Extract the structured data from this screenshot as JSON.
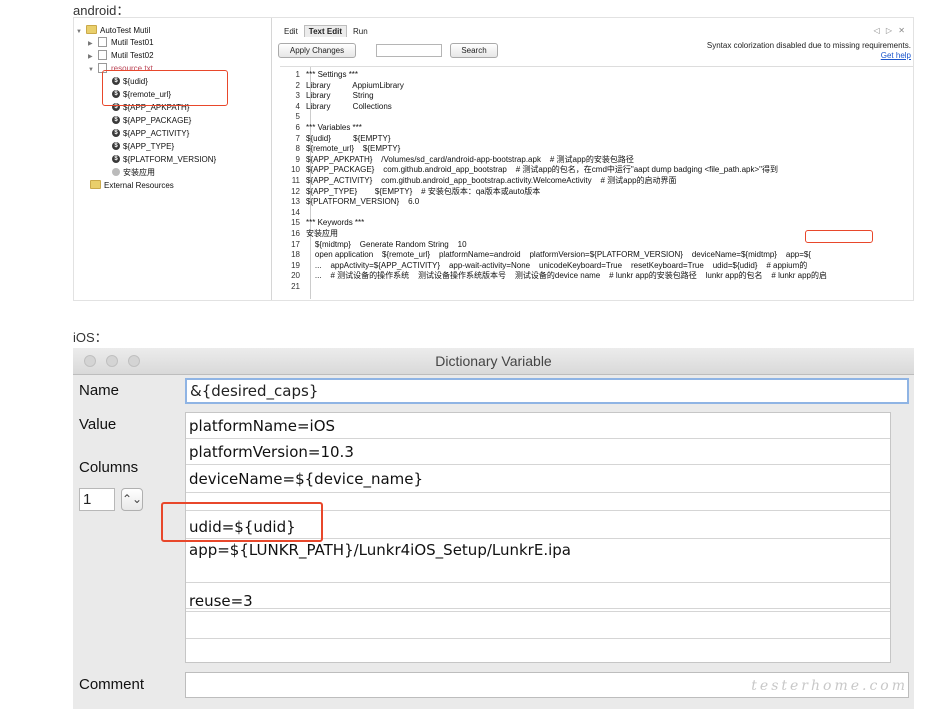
{
  "android_caption": "android：",
  "ios_caption": "iOS：",
  "android": {
    "tree": [
      {
        "label": "AutoTest Mutil",
        "type": "folder",
        "toggle": "▼"
      },
      {
        "label": "Mutil Test01",
        "type": "file",
        "toggle": "▶"
      },
      {
        "label": "Mutil Test02",
        "type": "file",
        "toggle": "▶"
      },
      {
        "label": "resource.txt",
        "type": "file",
        "toggle": "▼"
      },
      {
        "label": "${udid}",
        "type": "var"
      },
      {
        "label": "${remote_url}",
        "type": "var"
      },
      {
        "label": "${APP_APKPATH}",
        "type": "var"
      },
      {
        "label": "${APP_PACKAGE}",
        "type": "var"
      },
      {
        "label": "${APP_ACTIVITY}",
        "type": "var"
      },
      {
        "label": "${APP_TYPE}",
        "type": "var"
      },
      {
        "label": "${PLATFORM_VERSION}",
        "type": "var"
      },
      {
        "label": "安装应用",
        "type": "kw"
      },
      {
        "label": "External Resources",
        "type": "folder"
      }
    ],
    "tabs": [
      "Edit",
      "Text Edit",
      "Run"
    ],
    "tab_controls": "◁ ▷ ✕",
    "apply_button": "Apply Changes",
    "search_button": "Search",
    "syntax_message": "Syntax colorization disabled due to missing requirements.",
    "get_help": "Get help",
    "code_lines": [
      {
        "n": "1",
        "t": "*** Settings ***"
      },
      {
        "n": "2",
        "t": "Library          AppiumLibrary"
      },
      {
        "n": "3",
        "t": "Library          String"
      },
      {
        "n": "4",
        "t": "Library          Collections"
      },
      {
        "n": "5",
        "t": ""
      },
      {
        "n": "6",
        "t": "*** Variables ***"
      },
      {
        "n": "7",
        "t": "${udid}          ${EMPTY}"
      },
      {
        "n": "8",
        "t": "${remote_url}    ${EMPTY}"
      },
      {
        "n": "9",
        "t": "${APP_APKPATH}    /Volumes/sd_card/android-app-bootstrap.apk    # 测试app的安装包路径"
      },
      {
        "n": "10",
        "t": "${APP_PACKAGE}    com.github.android_app_bootstrap    # 测试app的包名，在cmd中运行\"aapt dump badging <file_path.apk>\"得到"
      },
      {
        "n": "11",
        "t": "${APP_ACTIVITY}    com.github.android_app_bootstrap.activity.WelcomeActivity    # 测试app的启动界面"
      },
      {
        "n": "12",
        "t": "${APP_TYPE}        ${EMPTY}    # 安装包版本：qa版本或auto版本"
      },
      {
        "n": "13",
        "t": "${PLATFORM_VERSION}    6.0"
      },
      {
        "n": "14",
        "t": ""
      },
      {
        "n": "15",
        "t": "*** Keywords ***"
      },
      {
        "n": "16",
        "t": "安装应用"
      },
      {
        "n": "17",
        "t": "    ${midtmp}    Generate Random String    10"
      },
      {
        "n": "18",
        "t": "    open application    ${remote_url}    platformName=android    platformVersion=${PLATFORM_VERSION}    deviceName=${midtmp}    app=${"
      },
      {
        "n": "19",
        "t": "    ...    appActivity=${APP_ACTIVITY}    app-wait-activity=None    unicodeKeyboard=True    resetKeyboard=True    udid=${udid}    # appium的"
      },
      {
        "n": "20",
        "t": "    ...    # 测试设备的操作系统    测试设备操作系统版本号    测试设备的device name    # lunkr app的安装包路径    lunkr app的包名    # lunkr app的启"
      },
      {
        "n": "21",
        "t": ""
      }
    ]
  },
  "ios": {
    "window_title": "Dictionary Variable",
    "name_label": "Name",
    "name_value": "&{desired_caps}",
    "value_label": "Value",
    "columns_label": "Columns",
    "columns_value": "1",
    "stepper_glyph": "⌃⌄",
    "comment_label": "Comment",
    "values": [
      "platformName=iOS",
      "platformVersion=10.3",
      "deviceName=${device_name}",
      "",
      "udid=${udid}",
      "app=${LUNKR_PATH}/Lunkr4iOS_Setup/LunkrE.ipa",
      "",
      "reuse=3",
      "",
      ""
    ],
    "watermark": "testerhome.com"
  },
  "colors": {
    "highlight": "#e8472b",
    "focus": "#8fb4e4",
    "link": "#1a55cc"
  }
}
